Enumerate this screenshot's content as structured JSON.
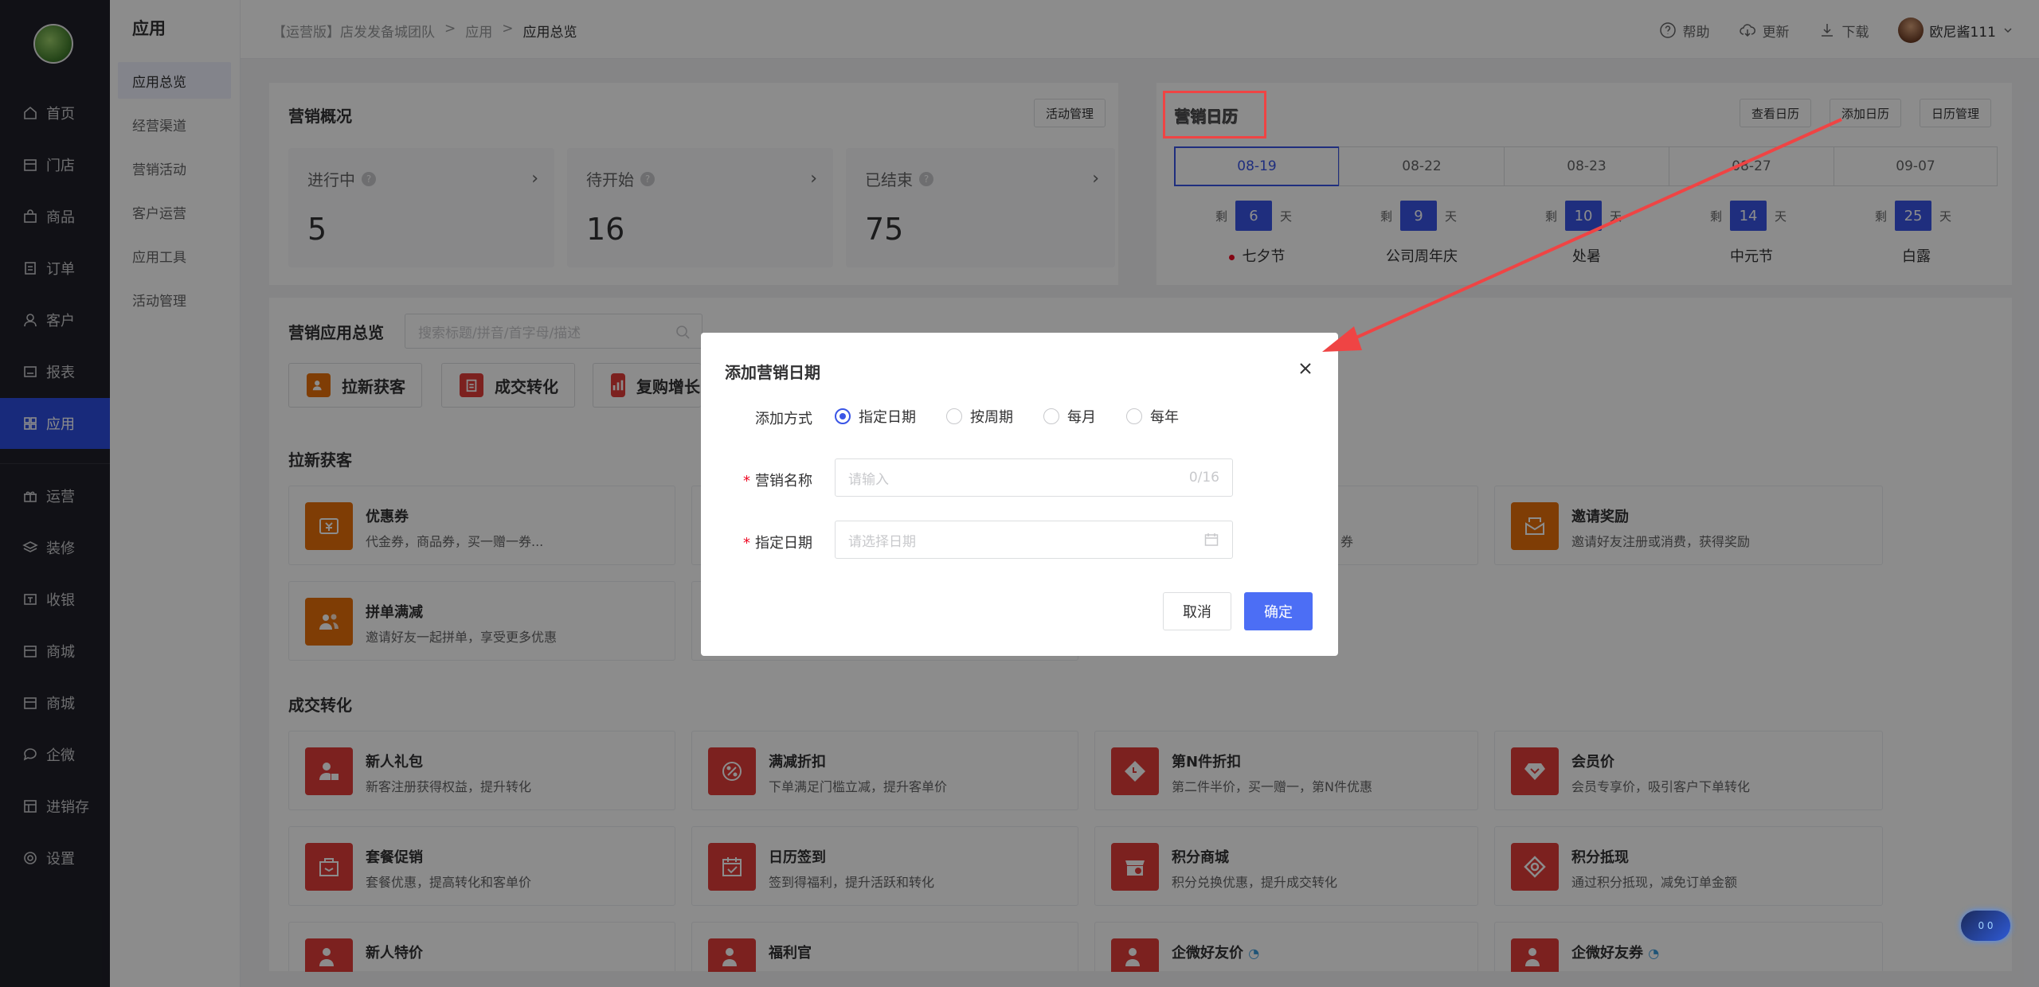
{
  "nav": {
    "items": [
      {
        "label": "首页",
        "icon": "home-icon"
      },
      {
        "label": "门店",
        "icon": "store-icon"
      },
      {
        "label": "商品",
        "icon": "bag-icon"
      },
      {
        "label": "订单",
        "icon": "order-icon"
      },
      {
        "label": "客户",
        "icon": "user-icon"
      },
      {
        "label": "报表",
        "icon": "report-icon"
      },
      {
        "label": "应用",
        "icon": "grid-icon",
        "active": true
      },
      {
        "label": "运营",
        "icon": "gift-icon"
      },
      {
        "label": "装修",
        "icon": "layers-icon"
      },
      {
        "label": "收银",
        "icon": "cashier-icon"
      },
      {
        "label": "商城",
        "icon": "shop-icon"
      },
      {
        "label": "商城",
        "icon": "shop-icon"
      },
      {
        "label": "企微",
        "icon": "chat-icon"
      },
      {
        "label": "进销存",
        "icon": "inventory-icon"
      },
      {
        "label": "设置",
        "icon": "settings-icon"
      }
    ]
  },
  "subnav": {
    "title": "应用",
    "items": [
      {
        "label": "应用总览",
        "active": true
      },
      {
        "label": "经营渠道"
      },
      {
        "label": "营销活动"
      },
      {
        "label": "客户运营"
      },
      {
        "label": "应用工具"
      },
      {
        "label": "活动管理"
      }
    ]
  },
  "topbar": {
    "crumbs": [
      "【运营版】店发发备城团队",
      ">",
      "应用",
      ">",
      "应用总览"
    ],
    "help": "帮助",
    "update": "更新",
    "download": "下载",
    "user": "欧尼酱111"
  },
  "overview": {
    "title": "营销概况",
    "manage_btn": "活动管理",
    "stats": [
      {
        "label": "进行中",
        "value": "5"
      },
      {
        "label": "待开始",
        "value": "16"
      },
      {
        "label": "已结束",
        "value": "75"
      }
    ]
  },
  "calendar": {
    "title": "营销日历",
    "view_btn": "查看日历",
    "add_btn": "添加日历",
    "manage_btn": "日历管理",
    "remain_prefix": "剩",
    "remain_suffix": "天",
    "dates": [
      {
        "date": "08-19",
        "days": "6",
        "festival": "七夕节",
        "active": true
      },
      {
        "date": "08-22",
        "days": "9",
        "festival": "公司周年庆"
      },
      {
        "date": "08-23",
        "days": "10",
        "festival": "处暑"
      },
      {
        "date": "08-27",
        "days": "14",
        "festival": "中元节"
      },
      {
        "date": "09-07",
        "days": "25",
        "festival": "白露"
      }
    ]
  },
  "apps": {
    "title": "营销应用总览",
    "search_placeholder": "搜索标题/拼音/首字母/描述",
    "categories": [
      {
        "label": "拉新获客",
        "color": "#e8700a"
      },
      {
        "label": "成交转化",
        "color": "#e23c39"
      },
      {
        "label": "复购增长",
        "color": "#e23c39"
      }
    ],
    "section1": {
      "title": "拉新获客",
      "items": [
        {
          "name": "优惠券",
          "desc": "代金券，商品券，买一赠一券...",
          "color": "#e8700a",
          "icon": "coupon-icon"
        },
        {
          "name": "",
          "desc": "券",
          "color": "#e8700a",
          "icon": "coupon-icon"
        },
        {
          "name": "邀请奖励",
          "desc": "邀请好友注册或消费，获得奖励",
          "color": "#e8700a",
          "icon": "envelope-icon"
        },
        {
          "name": "拼单满减",
          "desc": "邀请好友一起拼单，享受更多优惠",
          "color": "#e8700a",
          "icon": "group-icon"
        }
      ]
    },
    "section2": {
      "title": "成交转化",
      "items": [
        {
          "name": "新人礼包",
          "desc": "新客注册获得权益，提升转化",
          "color": "#e23c39",
          "icon": "newuser-icon"
        },
        {
          "name": "满减折扣",
          "desc": "下单满足门槛立减，提升客单价",
          "color": "#e23c39",
          "icon": "percent-icon"
        },
        {
          "name": "第N件折扣",
          "desc": "第二件半价，买一赠一，第N件优惠",
          "color": "#e23c39",
          "icon": "tag-icon"
        },
        {
          "name": "会员价",
          "desc": "会员专享价，吸引客户下单转化",
          "color": "#e23c39",
          "icon": "diamond-icon"
        },
        {
          "name": "套餐促销",
          "desc": "套餐优惠，提高转化和客单价",
          "color": "#e23c39",
          "icon": "package-icon"
        },
        {
          "name": "日历签到",
          "desc": "签到得福利，提升活跃和转化",
          "color": "#e23c39",
          "icon": "calendar-check-icon"
        },
        {
          "name": "积分商城",
          "desc": "积分兑换优惠，提升成交转化",
          "color": "#e23c39",
          "icon": "points-shop-icon"
        },
        {
          "name": "积分抵现",
          "desc": "通过积分抵现，减免订单金额",
          "color": "#e23c39",
          "icon": "points-icon"
        },
        {
          "name": "新人特价",
          "desc": "",
          "color": "#e23c39",
          "icon": "newuser-icon"
        },
        {
          "name": "福利官",
          "desc": "",
          "color": "#e23c39",
          "icon": "welfare-icon"
        },
        {
          "name": "企微好友价",
          "desc": "",
          "color": "#e23c39",
          "icon": "wecom-icon"
        },
        {
          "name": "企微好友券",
          "desc": "",
          "color": "#e23c39",
          "icon": "wecom-icon"
        }
      ]
    }
  },
  "modal": {
    "title": "添加营销日期",
    "method_label": "添加方式",
    "methods": [
      {
        "label": "指定日期",
        "selected": true
      },
      {
        "label": "按周期"
      },
      {
        "label": "每月"
      },
      {
        "label": "每年"
      }
    ],
    "name_label": "营销名称",
    "name_placeholder": "请输入",
    "name_count": "0/16",
    "date_label": "指定日期",
    "date_placeholder": "请选择日期",
    "cancel": "取消",
    "confirm": "确定"
  },
  "float_button": "0 0",
  "colors": {
    "primary": "#3a55e6",
    "nav_bg": "#1f2028",
    "highlight": "#ef4444",
    "orange": "#e8700a",
    "red": "#e23c39"
  }
}
